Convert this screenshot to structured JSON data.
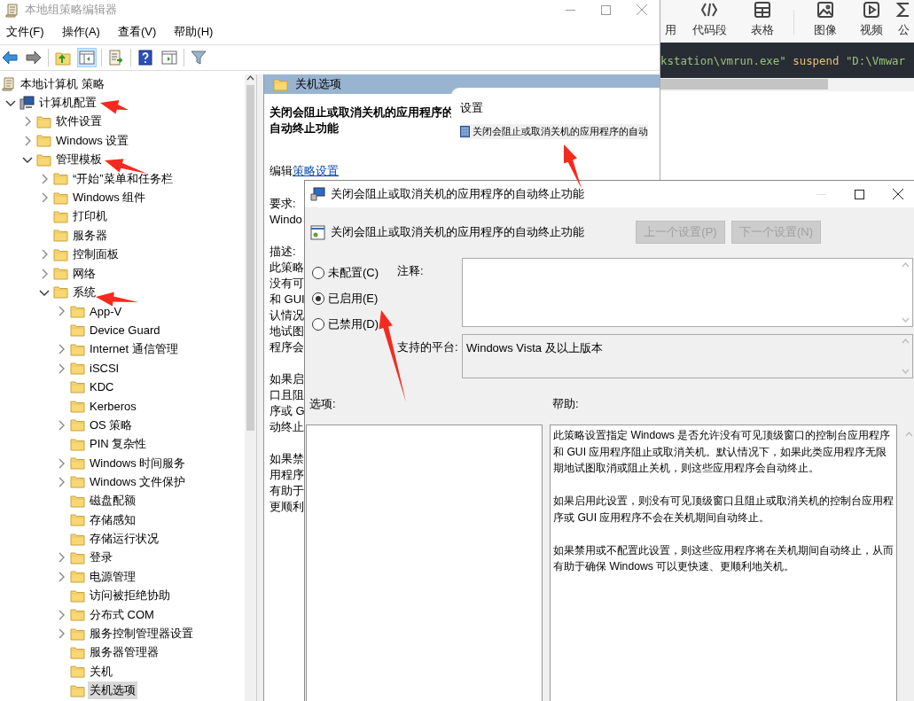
{
  "background_app": {
    "toolbar": [
      {
        "label": "用",
        "kind": "none"
      },
      {
        "label": "代码段",
        "kind": "code"
      },
      {
        "label": "表格",
        "kind": "table"
      },
      {
        "label": "图像",
        "kind": "image"
      },
      {
        "label": "视频",
        "kind": "video"
      },
      {
        "label": "公",
        "kind": "formula"
      }
    ],
    "code": [
      {
        "text": "kstation\\vmrun.exe\"",
        "kind": "string"
      },
      {
        "text": " suspend ",
        "kind": "plain"
      },
      {
        "text": "\"D:\\Vmwar",
        "kind": "string"
      }
    ]
  },
  "gpedit": {
    "title": "本地组策略编辑器",
    "menu": [
      "文件(F)",
      "操作(A)",
      "查看(V)",
      "帮助(H)"
    ],
    "tree": [
      {
        "label": "本地计算机 策略",
        "kind": "policy",
        "selected": false,
        "children": [
          {
            "label": "计算机配置",
            "kind": "computer",
            "expanded": true,
            "selected": false,
            "children": [
              {
                "label": "软件设置",
                "kind": "folder",
                "expanded": false,
                "selected": false
              },
              {
                "label": "Windows 设置",
                "kind": "folder",
                "expanded": false,
                "selected": false
              },
              {
                "label": "管理模板",
                "kind": "folder",
                "expanded": true,
                "selected": false,
                "children": [
                  {
                    "label": "“开始”菜单和任务栏",
                    "kind": "folder",
                    "expanded": false,
                    "selected": false
                  },
                  {
                    "label": "Windows 组件",
                    "kind": "folder",
                    "expanded": false,
                    "selected": false
                  },
                  {
                    "label": "打印机",
                    "kind": "folder",
                    "selected": false
                  },
                  {
                    "label": "服务器",
                    "kind": "folder",
                    "selected": false
                  },
                  {
                    "label": "控制面板",
                    "kind": "folder",
                    "expanded": false,
                    "selected": false
                  },
                  {
                    "label": "网络",
                    "kind": "folder",
                    "expanded": false,
                    "selected": false
                  },
                  {
                    "label": "系统",
                    "kind": "folder",
                    "expanded": true,
                    "selected": false,
                    "children": [
                      {
                        "label": "App-V",
                        "kind": "folder",
                        "expanded": false,
                        "selected": false
                      },
                      {
                        "label": "Device Guard",
                        "kind": "folder",
                        "selected": false
                      },
                      {
                        "label": "Internet 通信管理",
                        "kind": "folder",
                        "expanded": false,
                        "selected": false
                      },
                      {
                        "label": "iSCSI",
                        "kind": "folder",
                        "expanded": false,
                        "selected": false
                      },
                      {
                        "label": "KDC",
                        "kind": "folder",
                        "selected": false
                      },
                      {
                        "label": "Kerberos",
                        "kind": "folder",
                        "selected": false
                      },
                      {
                        "label": "OS 策略",
                        "kind": "folder",
                        "expanded": false,
                        "selected": false
                      },
                      {
                        "label": "PIN 复杂性",
                        "kind": "folder",
                        "selected": false
                      },
                      {
                        "label": "Windows 时间服务",
                        "kind": "folder",
                        "expanded": false,
                        "selected": false
                      },
                      {
                        "label": "Windows 文件保护",
                        "kind": "folder",
                        "expanded": false,
                        "selected": false
                      },
                      {
                        "label": "磁盘配额",
                        "kind": "folder",
                        "selected": false
                      },
                      {
                        "label": "存储感知",
                        "kind": "folder",
                        "selected": false
                      },
                      {
                        "label": "存储运行状况",
                        "kind": "folder",
                        "selected": false
                      },
                      {
                        "label": "登录",
                        "kind": "folder",
                        "expanded": false,
                        "selected": false
                      },
                      {
                        "label": "电源管理",
                        "kind": "folder",
                        "expanded": false,
                        "selected": false
                      },
                      {
                        "label": "访问被拒绝协助",
                        "kind": "folder",
                        "selected": false
                      },
                      {
                        "label": "分布式 COM",
                        "kind": "folder",
                        "expanded": false,
                        "selected": false
                      },
                      {
                        "label": "服务控制管理器设置",
                        "kind": "folder",
                        "expanded": false,
                        "selected": false
                      },
                      {
                        "label": "服务器管理器",
                        "kind": "folder",
                        "selected": false
                      },
                      {
                        "label": "关机",
                        "kind": "folder",
                        "selected": false
                      },
                      {
                        "label": "关机选项",
                        "kind": "folder",
                        "selected": true
                      }
                    ]
                  }
                ]
              }
            ]
          }
        ]
      }
    ],
    "details": {
      "header": "关机选项",
      "title": "关闭会阻止或取消关机的应用程序的自动终止功能",
      "edit_prefix": "编辑",
      "edit_link": "策略设置",
      "requirements_label": "要求:",
      "requirements": "Windo",
      "description_label": "描述:",
      "description": [
        [
          "此策略",
          "没有可",
          "和 GUI",
          "认情况",
          "地试图",
          "程序会"
        ],
        [
          "如果启",
          "口且阻",
          "序或 G",
          "动终止"
        ],
        [
          "如果禁",
          "用程序",
          "有助于",
          "更顺利"
        ]
      ],
      "settings_header": "设置",
      "settings_item": "关闭会阻止或取消关机的应用程序的自动"
    }
  },
  "dialog": {
    "title": "关闭会阻止或取消关机的应用程序的自动终止功能",
    "heading": "关闭会阻止或取消关机的应用程序的自动终止功能",
    "buttons": [
      {
        "label": "上一个设置(P)",
        "disabled": true
      },
      {
        "label": "下一个设置(N)",
        "disabled": true
      }
    ],
    "radios": [
      {
        "label": "未配置(C)",
        "selected": false
      },
      {
        "label": "已启用(E)",
        "selected": true
      },
      {
        "label": "已禁用(D)",
        "selected": false
      }
    ],
    "comment_label": "注释:",
    "platform_label": "支持的平台:",
    "platform": "Windows Vista 及以上版本",
    "options_label": "选项:",
    "help_label": "帮助:",
    "help": [
      "此策略设置指定 Windows 是否允许没有可见顶级窗口的控制台应用程序和 GUI 应用程序阻止或取消关机。默认情况下，如果此类应用程序无限期地试图取消或阻止关机，则这些应用程序会自动终止。",
      "如果启用此设置，则没有可见顶级窗口且阻止或取消关机的控制台应用程序或 GUI 应用程序不会在关机期间自动终止。",
      "如果禁用或不配置此设置，则这些应用程序将在关机期间自动终止，从而有助于确保 Windows 可以更快速、更顺利地关机。"
    ]
  }
}
